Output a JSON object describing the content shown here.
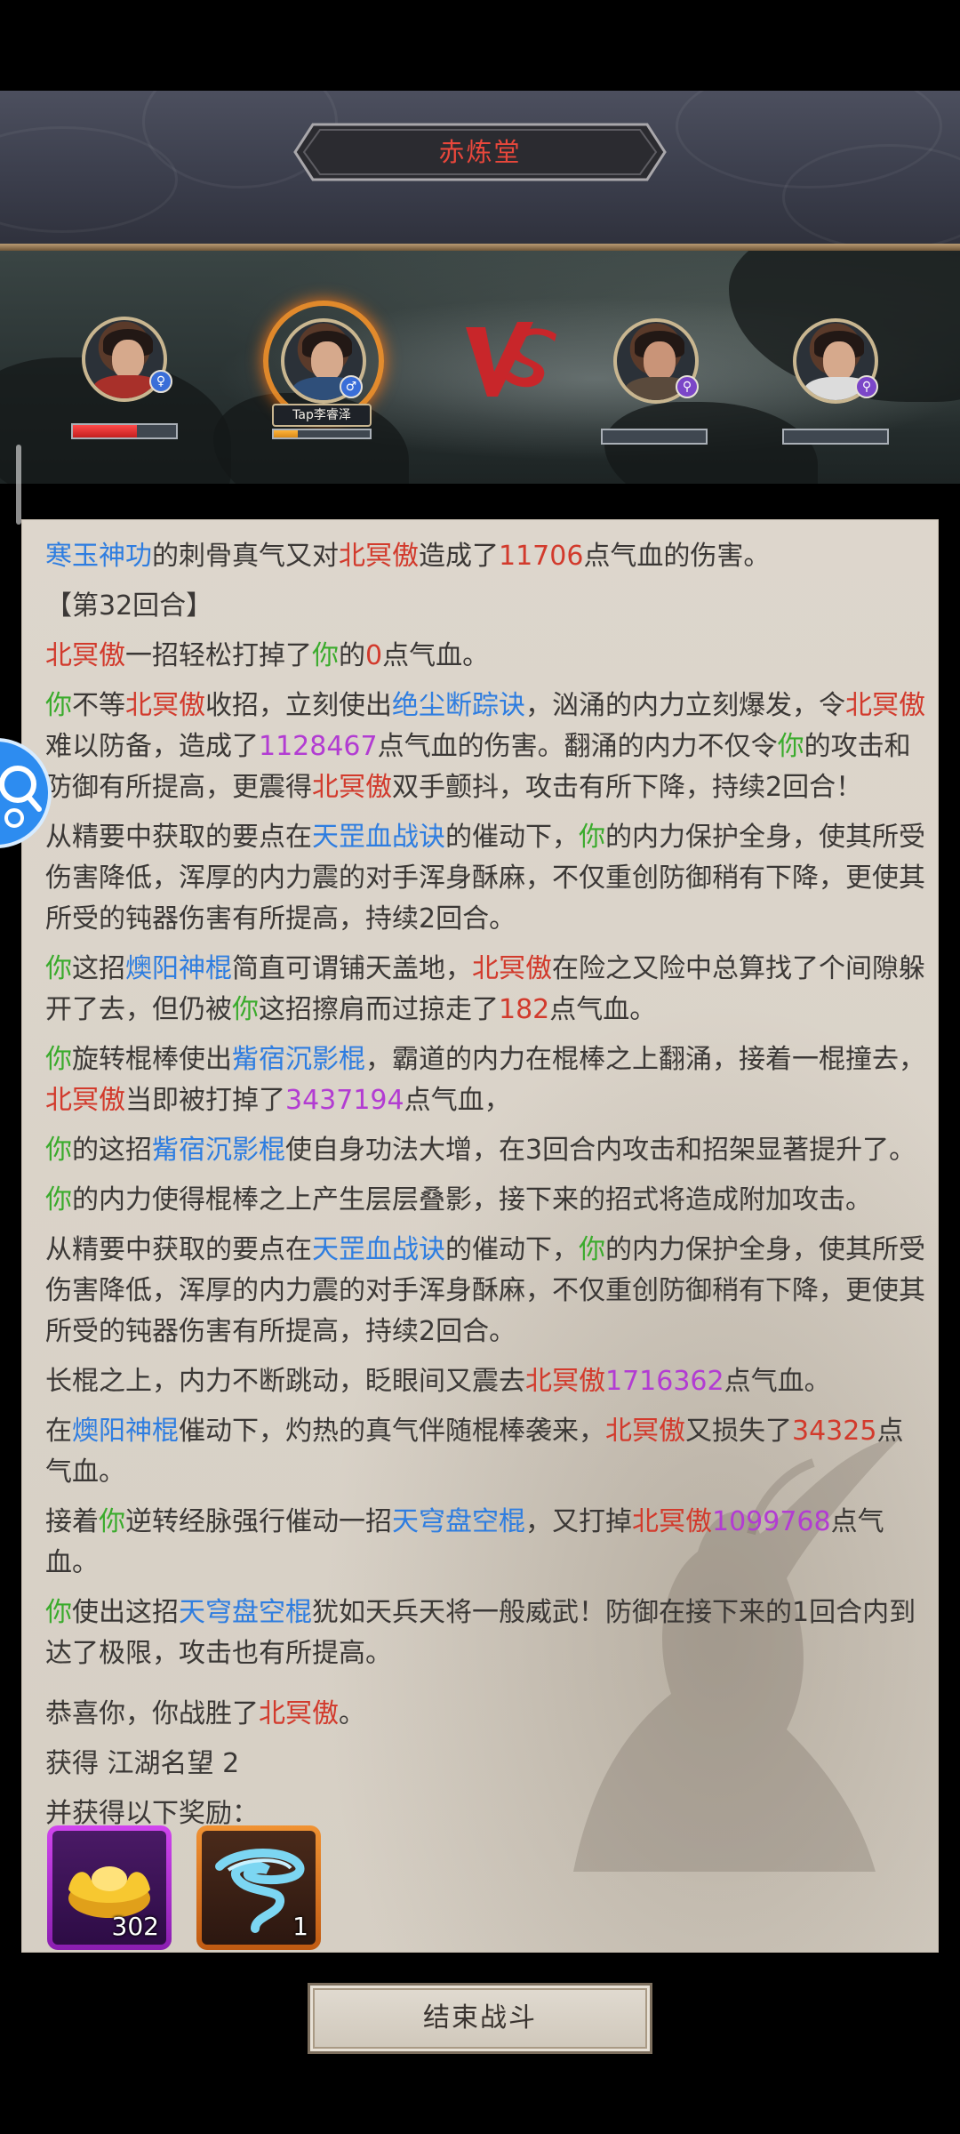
{
  "header": {
    "title": "赤炼堂"
  },
  "battle": {
    "allies": [
      {
        "badge_icon": "gender-female-icon",
        "hp": 0.62
      },
      {
        "badge_icon": "gender-male-icon",
        "tap_label": "Tap李睿泽",
        "hp": 0.25,
        "active": true
      }
    ],
    "enemies": [
      {
        "badge_icon": "gender-unknown-icon",
        "hp": 0.0
      },
      {
        "badge_icon": "gender-unknown-icon",
        "hp": 0.0
      }
    ]
  },
  "log": {
    "lines": [
      [
        [
          "寒玉神功",
          "blue"
        ],
        [
          "的刺骨真气又对",
          ""
        ],
        [
          "北冥傲",
          "red"
        ],
        [
          "造成了",
          ""
        ],
        [
          "11706",
          "red"
        ],
        [
          "点气血的伤害。",
          ""
        ]
      ],
      [
        [
          "【第32回合】",
          ""
        ]
      ],
      [
        [
          "北冥傲",
          "red"
        ],
        [
          "一招轻松打掉了",
          ""
        ],
        [
          "你",
          "green"
        ],
        [
          "的",
          ""
        ],
        [
          "0",
          "red"
        ],
        [
          "点气血。",
          ""
        ]
      ],
      [
        [
          "你",
          "green"
        ],
        [
          "不等",
          ""
        ],
        [
          "北冥傲",
          "red"
        ],
        [
          "收招，立刻使出",
          ""
        ],
        [
          "绝尘断踪诀",
          "blue"
        ],
        [
          "，汹涌的内力立刻爆发，令",
          ""
        ],
        [
          "北冥傲",
          "red"
        ],
        [
          "难以防备，造成了",
          ""
        ],
        [
          "1128467",
          "purple"
        ],
        [
          "点气血的伤害。翻涌的内力不仅令",
          ""
        ],
        [
          "你",
          "green"
        ],
        [
          "的攻击和防御有所提高，更震得",
          ""
        ],
        [
          "北冥傲",
          "red"
        ],
        [
          "双手颤抖，攻击有所下降，持续2回合！",
          ""
        ]
      ],
      [
        [
          "从精要中获取的要点在",
          ""
        ],
        [
          "天罡血战诀",
          "blue"
        ],
        [
          "的催动下，",
          ""
        ],
        [
          "你",
          "green"
        ],
        [
          "的内力保护全身，使其所受伤害降低，浑厚的内力震的对手浑身酥麻，不仅重创防御稍有下降，更使其所受的钝器伤害有所提高，持续2回合。",
          ""
        ]
      ],
      [
        [
          "你",
          "green"
        ],
        [
          "这招",
          ""
        ],
        [
          "燠阳神棍",
          "blue"
        ],
        [
          "简直可谓铺天盖地，",
          ""
        ],
        [
          "北冥傲",
          "red"
        ],
        [
          "在险之又险中总算找了个间隙躲开了去，但仍被",
          ""
        ],
        [
          "你",
          "green"
        ],
        [
          "这招擦肩而过掠走了",
          ""
        ],
        [
          "182",
          "red"
        ],
        [
          "点气血。",
          ""
        ]
      ],
      [
        [
          "你",
          "green"
        ],
        [
          "旋转棍棒使出",
          ""
        ],
        [
          "觜宿沉影棍",
          "blue"
        ],
        [
          "，霸道的内力在棍棒之上翻涌，接着一棍撞去，",
          ""
        ],
        [
          "北冥傲",
          "red"
        ],
        [
          "当即被打掉了",
          ""
        ],
        [
          "3437194",
          "purple"
        ],
        [
          "点气血，",
          ""
        ]
      ],
      [
        [
          "你",
          "green"
        ],
        [
          "的这招",
          ""
        ],
        [
          "觜宿沉影棍",
          "blue"
        ],
        [
          "使自身功法大增，在3回合内攻击和招架显著提升了。",
          ""
        ]
      ],
      [
        [
          "你",
          "green"
        ],
        [
          "的内力使得棍棒之上产生层层叠影，接下来的招式将造成附加攻击。",
          ""
        ]
      ],
      [
        [
          "从精要中获取的要点在",
          ""
        ],
        [
          "天罡血战诀",
          "blue"
        ],
        [
          "的催动下，",
          ""
        ],
        [
          "你",
          "green"
        ],
        [
          "的内力保护全身，使其所受伤害降低，浑厚的内力震的对手浑身酥麻，不仅重创防御稍有下降，更使其所受的钝器伤害有所提高，持续2回合。",
          ""
        ]
      ],
      [
        [
          "长棍之上，内力不断跳动，眨眼间又震去",
          ""
        ],
        [
          "北冥傲",
          "red"
        ],
        [
          "1716362",
          "purple"
        ],
        [
          "点气血。",
          ""
        ]
      ],
      [
        [
          "在",
          ""
        ],
        [
          "燠阳神棍",
          "blue"
        ],
        [
          "催动下，灼热的真气伴随棍棒袭来，",
          ""
        ],
        [
          "北冥傲",
          "red"
        ],
        [
          "又损失了",
          ""
        ],
        [
          "34325",
          "red"
        ],
        [
          "点气血。",
          ""
        ]
      ],
      [
        [
          "接着",
          ""
        ],
        [
          "你",
          "green"
        ],
        [
          "逆转经脉强行催动一招",
          ""
        ],
        [
          "天穹盘空棍",
          "blue"
        ],
        [
          "，又打掉",
          ""
        ],
        [
          "北冥傲",
          "red"
        ],
        [
          "1099768",
          "purple"
        ],
        [
          "点气血。",
          ""
        ]
      ],
      [
        [
          "你",
          "green"
        ],
        [
          "使出这招",
          ""
        ],
        [
          "天穹盘空棍",
          "blue"
        ],
        [
          "犹如天兵天将一般威武！防御在接下来的1回合内到达了极限，攻击也有所提高。",
          ""
        ]
      ],
      [
        [
          "恭喜你，你战胜了",
          ""
        ],
        [
          "北冥傲",
          "red"
        ],
        [
          "。",
          ""
        ]
      ],
      [
        [
          "获得 ",
          ""
        ],
        [
          "江湖名望 2",
          ""
        ]
      ],
      [
        [
          "并获得以下奖励：",
          ""
        ]
      ]
    ]
  },
  "rewards": [
    {
      "icon": "gold-ingot-icon",
      "count": "302",
      "rarity": "purple"
    },
    {
      "icon": "blue-whirlwind-icon",
      "count": "1",
      "rarity": "orange"
    }
  ],
  "footer": {
    "end_button_label": "结束战斗"
  },
  "colors": {
    "skill": "#2e7de0",
    "enemy": "#d23a2c",
    "player": "#3aab2c",
    "big_damage": "#b23cd2"
  }
}
